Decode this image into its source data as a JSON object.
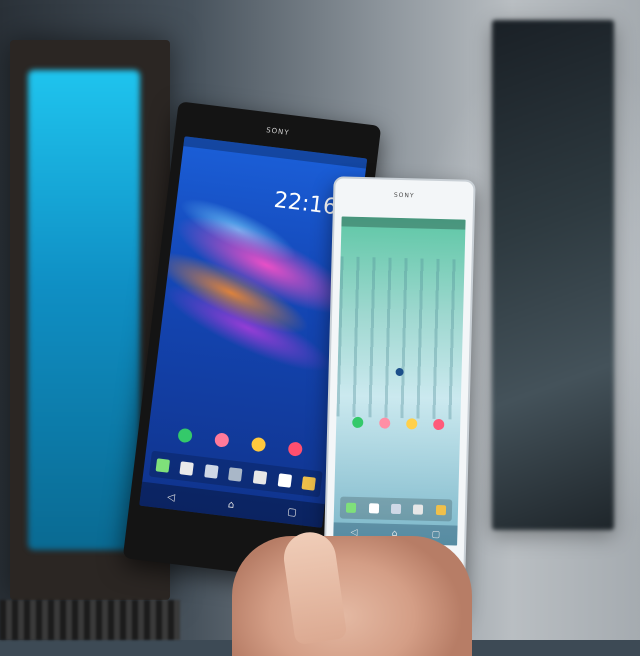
{
  "scene": {
    "description_colors": {
      "window_glass": "#1fc4ee",
      "big_phone_body": "#141414",
      "small_phone_body": "#f3f6f8"
    }
  },
  "big_phone": {
    "brand": "SONY",
    "clock": "22:16",
    "nav_icons": [
      "back-icon",
      "home-icon",
      "recents-icon"
    ]
  },
  "small_phone": {
    "brand": "SONY",
    "nav_icons": [
      "back-icon",
      "home-icon",
      "recents-icon"
    ]
  }
}
